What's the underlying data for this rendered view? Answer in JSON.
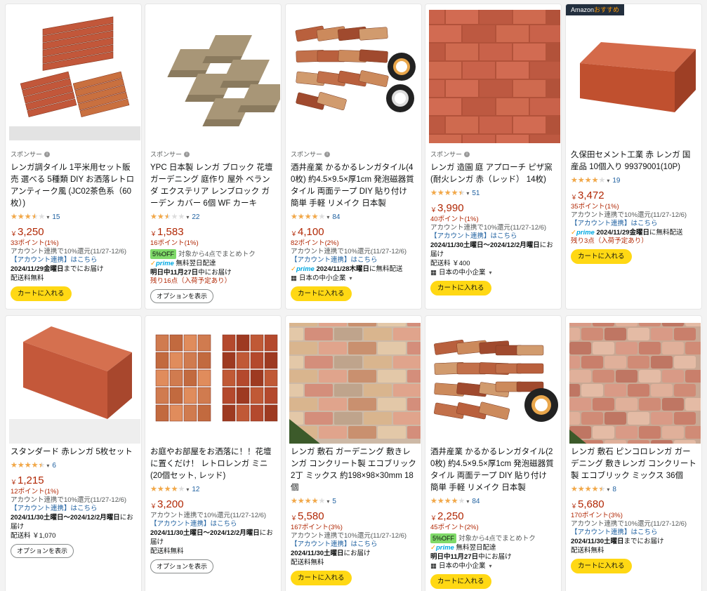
{
  "labels": {
    "sponsored": "スポンサー",
    "cart": "カートに入れる",
    "options": "オプションを表示",
    "prime": "prime",
    "badge_prefix": "Amazon",
    "badge_suffix": "おすすめ"
  },
  "products": [
    {
      "sponsored": true,
      "title": "レンガ調タイル 1平米用セット販売 選べる 5種類 DIY お洒落レトロ アンティーク風 (JC02茶色系（60枚）)",
      "rating": 3.5,
      "reviews": "15",
      "price": "3,250",
      "points": "33ポイント(1%)",
      "account": "アカウント連携で10%還元(11/27-12/6)",
      "link": "【アカウント連携】はこちら",
      "delivery_bold": "2024/11/29金曜日",
      "delivery_rest": "までにお届け",
      "ship": "配送料無料",
      "button": "cart"
    },
    {
      "sponsored": true,
      "title": "YPC 日本製 レンガ ブロック 花壇 ガーデニング 庭作り 屋外 ベランダ エクステリア レンブロック ガーデン カバー 6個 WF カーキ",
      "rating": 2.5,
      "reviews": "22",
      "price": "1,583",
      "points": "16ポイント(1%)",
      "off": "5%OFF",
      "off_text": "対象から4点でまとめトク",
      "prime_text": "無料翌日配達",
      "delivery_bold": "明日中11月27日",
      "delivery_rest": "中にお届け",
      "stock": "残り16点（入荷予定あり）",
      "button": "options"
    },
    {
      "sponsored": true,
      "title": "酒井産業 かるかるレンガタイル(40枚) 約4.5×9.5×厚1cm 発泡磁器質タイル 両面テープ DIY 貼り付け 簡単 手軽 リメイク 日本製",
      "rating": 4.0,
      "reviews": "84",
      "price": "4,100",
      "points": "82ポイント(2%)",
      "account": "アカウント連携で10%還元(11/27-12/6)",
      "link": "【アカウント連携】はこちら",
      "prime_bold": "2024/11/28木曜日",
      "prime_text": "に無料配送",
      "seller": "日本の中小企業",
      "button": "cart"
    },
    {
      "sponsored": true,
      "title": "レンガ 造園 庭 アプローチ ピザ窯 (耐火レンガ 赤（レッド） 14枚)",
      "rating": 4.5,
      "reviews": "51",
      "price": "3,990",
      "points": "40ポイント(1%)",
      "account": "アカウント連携で10%還元(11/27-12/6)",
      "link": "【アカウント連携】はこちら",
      "delivery_bold": "2024/11/30土曜日～2024/12/2月曜日",
      "delivery_rest": "にお届け",
      "ship": "配送料 ￥400",
      "seller": "日本の中小企業",
      "button": "cart"
    },
    {
      "sponsored": false,
      "badge": true,
      "title": "久保田セメント工業 赤 レンガ 国産品 10個入り 99379001(10P)",
      "rating": 4.0,
      "reviews": "19",
      "price": "3,472",
      "points": "35ポイント(1%)",
      "account": "アカウント連携で10%還元(11/27-12/6)",
      "link": "【アカウント連携】はこちら",
      "prime_bold": "2024/11/29金曜日",
      "prime_text": "に無料配送",
      "stock": "残り3点（入荷予定あり）",
      "button": "cart"
    },
    {
      "sponsored": false,
      "title": "スタンダード 赤レンガ 5枚セット",
      "rating": 4.5,
      "reviews": "6",
      "price": "1,215",
      "points": "12ポイント(1%)",
      "account": "アカウント連携で10%還元(11/27-12/6)",
      "link": "【アカウント連携】はこちら",
      "delivery_bold": "2024/11/30土曜日～2024/12/2月曜日",
      "delivery_rest": "にお届け",
      "ship": "配送料 ￥1,070",
      "button": "options"
    },
    {
      "sponsored": false,
      "title": "お庭やお部屋をお洒落に！！花壇に置くだけ！ レトロレンガ ミニ (20個セット, レッド)",
      "rating": 4.0,
      "reviews": "12",
      "price": "3,200",
      "account": "アカウント連携で10%還元(11/27-12/6)",
      "link": "【アカウント連携】はこちら",
      "delivery_bold": "2024/11/30土曜日～2024/12/2月曜日",
      "delivery_rest": "にお届け",
      "ship": "配送料無料",
      "button": "options"
    },
    {
      "sponsored": false,
      "title": "レンガ 敷石 ガーデニング 敷きレンガ コンクリート製 エコブリック 2丁 ミックス 約198×98×30mm 18個",
      "rating": 4.0,
      "reviews": "5",
      "price": "5,580",
      "points": "167ポイント(3%)",
      "account": "アカウント連携で10%還元(11/27-12/6)",
      "link": "【アカウント連携】はこちら",
      "delivery_bold": "2024/11/30土曜日",
      "delivery_rest": "にお届け",
      "ship": "配送料無料",
      "button": "cart"
    },
    {
      "sponsored": false,
      "title": "酒井産業 かるかるレンガタイル(20枚) 約4.5×9.5×厚1cm 発泡磁器質タイル 両面テープ DIY 貼り付け 簡単 手軽 リメイク 日本製",
      "rating": 4.0,
      "reviews": "84",
      "price": "2,250",
      "points": "45ポイント(2%)",
      "off": "5%OFF",
      "off_text": "対象から4点でまとめトク",
      "prime_text": "無料翌日配達",
      "delivery_bold": "明日中11月27日",
      "delivery_rest": "中にお届け",
      "seller": "日本の中小企業",
      "button": "cart"
    },
    {
      "sponsored": false,
      "title": "レンガ 敷石 ピンコロレンガ ガーデニング 敷きレンガ コンクリート製 エコブリック ミックス 36個",
      "rating": 4.5,
      "reviews": "8",
      "price": "5,680",
      "points": "170ポイント(3%)",
      "account": "アカウント連携で10%還元(11/27-12/6)",
      "link": "【アカウント連携】はこちら",
      "delivery_bold": "2024/11/30土曜日",
      "delivery_rest": "までにお届け",
      "ship": "配送料無料",
      "button": "cart"
    }
  ]
}
